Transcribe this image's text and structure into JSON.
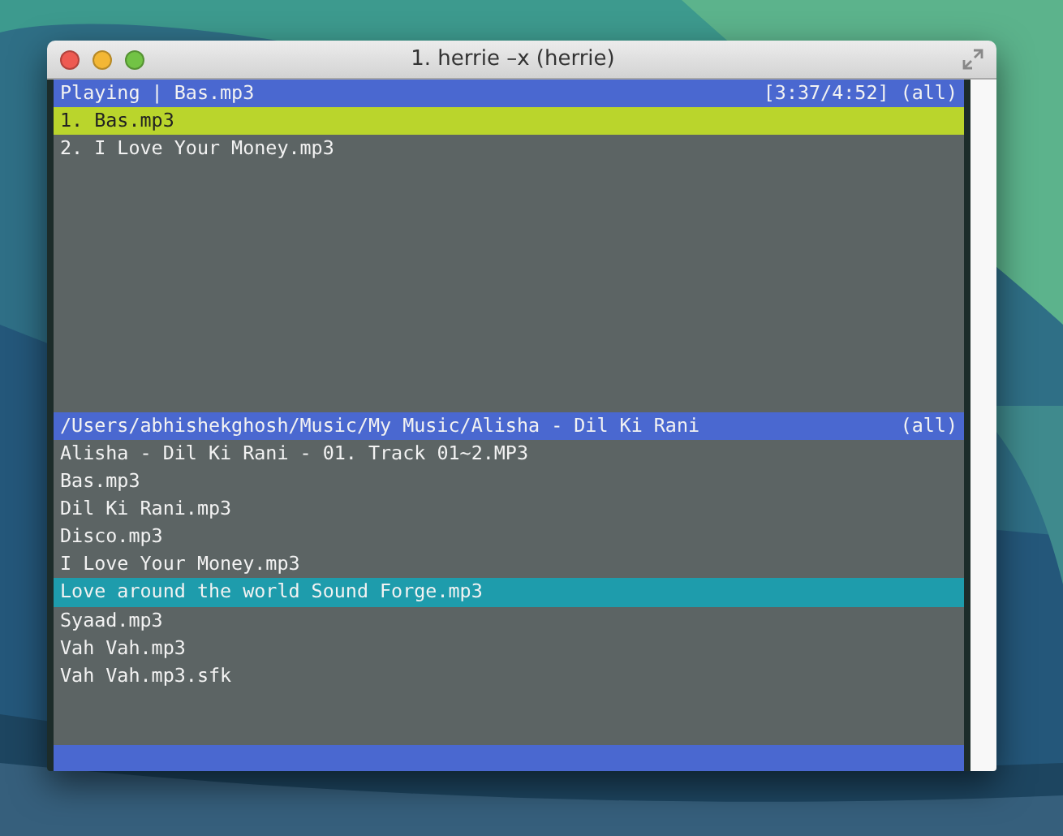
{
  "window": {
    "title": "1. herrie –x (herrie)"
  },
  "playlist": {
    "status": "Playing | Bas.mp3",
    "position": "[3:37/4:52] (all)",
    "items": [
      {
        "text": "1. Bas.mp3",
        "selected": true
      },
      {
        "text": "2. I Love Your Money.mp3",
        "selected": false
      }
    ]
  },
  "browser": {
    "path": "/Users/abhishekghosh/Music/My Music/Alisha - Dil Ki Rani",
    "mode": "(all)",
    "items": [
      {
        "text": "Alisha - Dil Ki Rani - 01. Track 01~2.MP3",
        "selected": false
      },
      {
        "text": "Bas.mp3",
        "selected": false
      },
      {
        "text": "Dil Ki Rani.mp3",
        "selected": false
      },
      {
        "text": "Disco.mp3",
        "selected": false
      },
      {
        "text": "I Love Your Money.mp3",
        "selected": false
      },
      {
        "text": "Love around the world Sound Forge.mp3",
        "selected": true
      },
      {
        "text": "Syaad.mp3",
        "selected": false
      },
      {
        "text": "Vah Vah.mp3",
        "selected": false
      },
      {
        "text": "Vah Vah.mp3.sfk",
        "selected": false
      }
    ]
  }
}
